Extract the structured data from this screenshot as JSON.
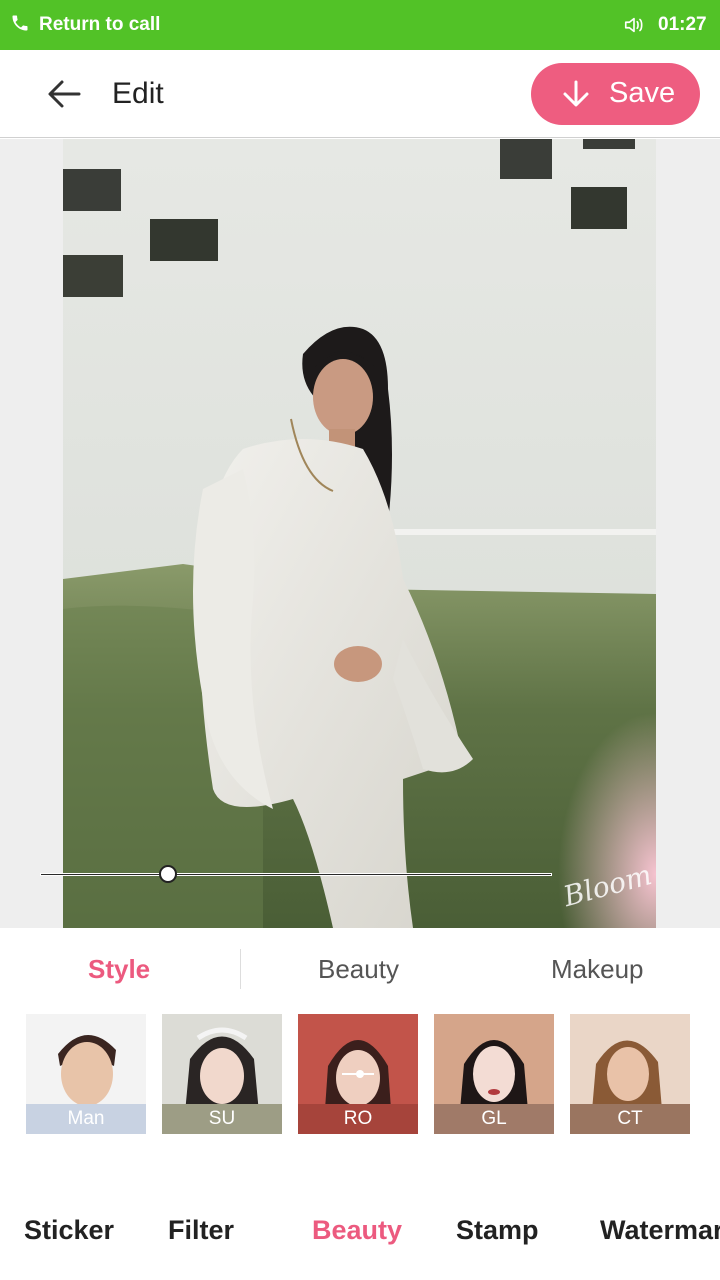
{
  "status_bar": {
    "call_text": "Return to call",
    "time": "01:27",
    "phone_icon": "phone-icon",
    "volume_icon": "speaker-icon",
    "bg_color": "#52c227"
  },
  "header": {
    "title": "Edit",
    "save_label": "Save",
    "accent_color": "#ee5d80"
  },
  "canvas": {
    "watermark_text": "Bloom",
    "intensity": 0.25
  },
  "sub_tabs": {
    "items": [
      "Style",
      "Beauty",
      "Makeup"
    ],
    "active": "Style"
  },
  "styles": {
    "items": [
      {
        "label": "Man"
      },
      {
        "label": "SU"
      },
      {
        "label": "RO"
      },
      {
        "label": "GL"
      },
      {
        "label": "CT"
      }
    ]
  },
  "bottom_nav": {
    "items": [
      "Sticker",
      "Filter",
      "Beauty",
      "Stamp",
      "Watermar"
    ],
    "active": "Beauty"
  }
}
